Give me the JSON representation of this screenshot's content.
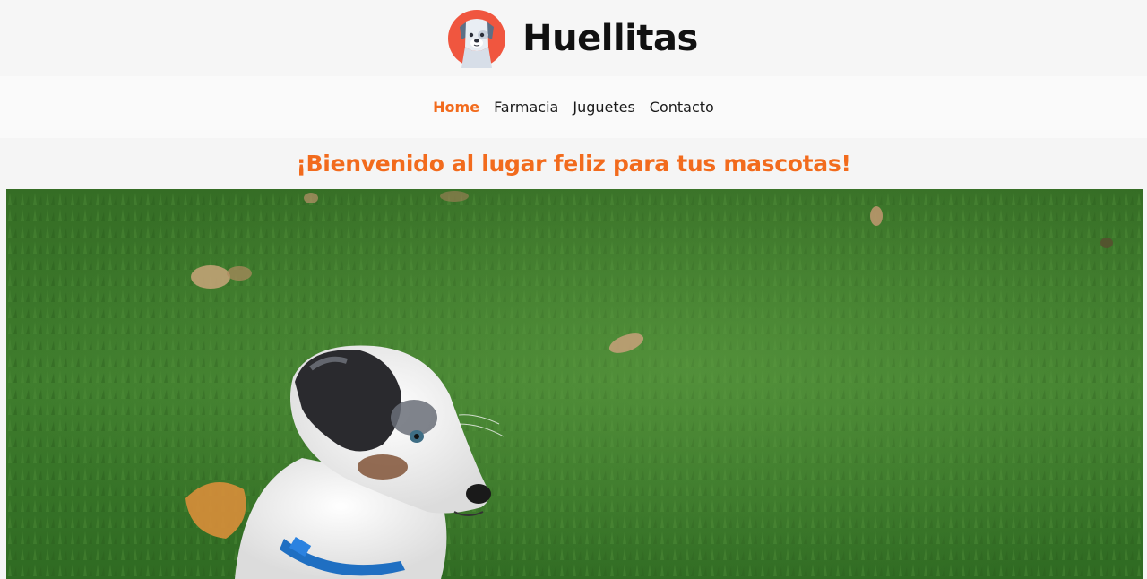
{
  "header": {
    "brand_name": "Huellitas",
    "logo_icon": "dog-face-logo-icon"
  },
  "nav": {
    "items": [
      {
        "label": "Home",
        "active": true
      },
      {
        "label": "Farmacia",
        "active": false
      },
      {
        "label": "Juguetes",
        "active": false
      },
      {
        "label": "Contacto",
        "active": false
      }
    ]
  },
  "welcome": {
    "title": "¡Bienvenido al lugar feliz para tus mascotas!"
  },
  "colors": {
    "accent": "#f26b1d",
    "logo_circle": "#f0563f",
    "grass": "#3f7a2c"
  }
}
